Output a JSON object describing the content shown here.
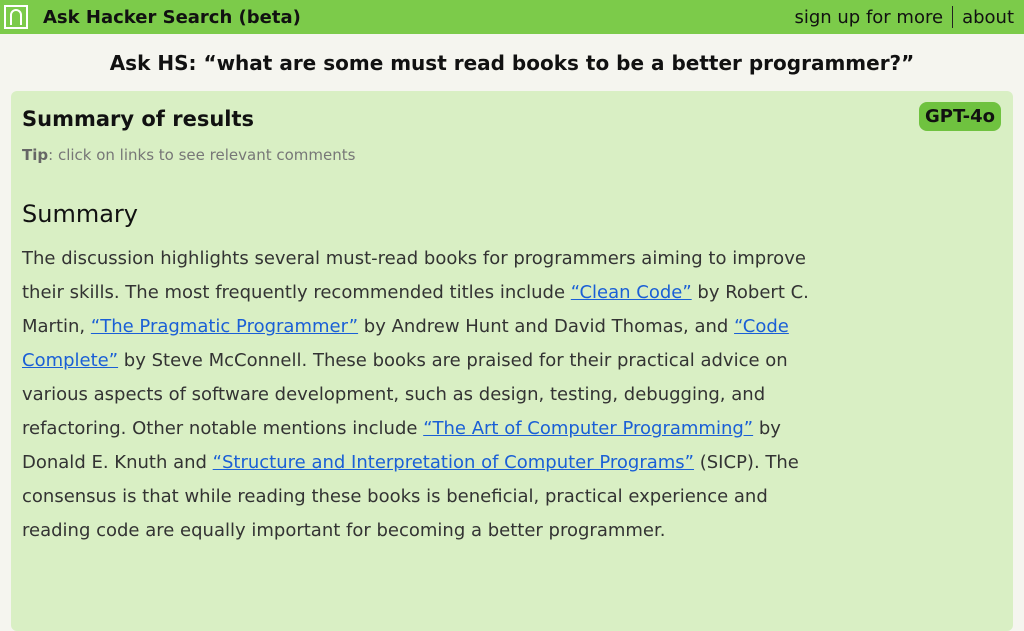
{
  "header": {
    "title": "Ask Hacker Search (beta)",
    "nav": {
      "signup": "sign up for more",
      "about": "about"
    }
  },
  "question": "Ask HS: “what are some must read books to be a better programmer?”",
  "results": {
    "title": "Summary of results",
    "model_badge": "GPT-4o",
    "tip_label": "Tip",
    "tip_text": ": click on links to see relevant comments",
    "summary_heading": "Summary",
    "summary": {
      "t1": "The discussion highlights several must-read books for programmers aiming to improve their skills. The most frequently recommended titles include ",
      "link1": "“Clean Code”",
      "t2": " by Robert C. Martin, ",
      "link2": "“The Pragmatic Programmer”",
      "t3": " by Andrew Hunt and David Thomas, and ",
      "link3": "“Code Complete”",
      "t4": " by Steve McConnell. These books are praised for their practical advice on various aspects of software development, such as design, testing, debugging, and refactoring. Other notable mentions include ",
      "link4": "“The Art of Computer Programming”",
      "t5": " by Donald E. Knuth and ",
      "link5": "“Structure and Interpretation of Computer Programs”",
      "t6": " (SICP). The consensus is that while reading these books is beneficial, practical experience and reading code are equally important for becoming a better programmer."
    }
  },
  "colors": {
    "topbar": "#7ccb4a",
    "panel": "#d9efc4",
    "badge": "#6fc23f",
    "link": "#1a5fd6"
  }
}
